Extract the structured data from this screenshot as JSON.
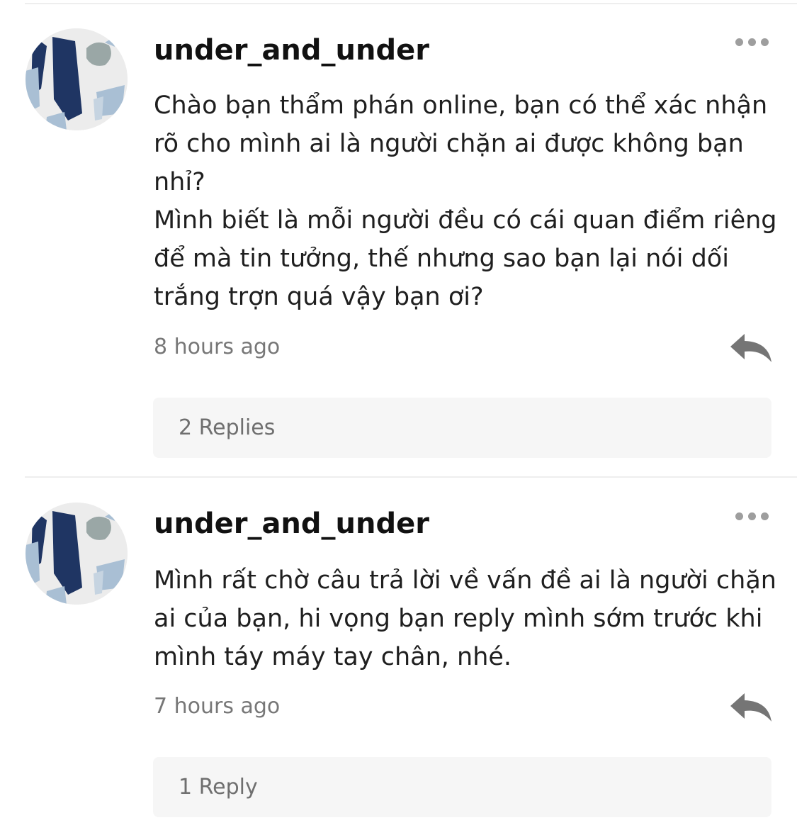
{
  "comments": [
    {
      "username": "under_and_under",
      "body_lines": [
        "Chào bạn thẩm phán online, bạn có thể xác nhận",
        "rõ cho mình ai là người chặn ai được không bạn",
        "nhỉ?",
        "Mình biết là mỗi người đều có cái quan điểm riêng",
        "để mà tin tưởng, thế nhưng sao bạn lại nói dối",
        "trắng trợn quá vậy bạn ơi?"
      ],
      "timestamp": "8 hours ago",
      "replies_label": "2 Replies",
      "more_icon": "more-horizontal-icon",
      "reply_icon": "reply-arrow-icon"
    },
    {
      "username": "under_and_under",
      "body_lines": [
        "Mình rất chờ câu trả lời về vấn đề ai là người chặn",
        "ai của bạn, hi vọng bạn reply mình sớm trước khi",
        "mình táy máy tay chân, nhé."
      ],
      "timestamp": "7 hours ago",
      "replies_label": "1 Reply",
      "more_icon": "more-horizontal-icon",
      "reply_icon": "reply-arrow-icon"
    }
  ],
  "colors": {
    "text": "#1f1f1f",
    "muted": "#777777",
    "icon_gray": "#757575",
    "dots_gray": "#9e9e9e",
    "reply_bar_bg": "#f6f6f6",
    "divider": "#eeeeee",
    "avatar_navy": "#1f3563",
    "avatar_blue": "#a9bfd4"
  }
}
